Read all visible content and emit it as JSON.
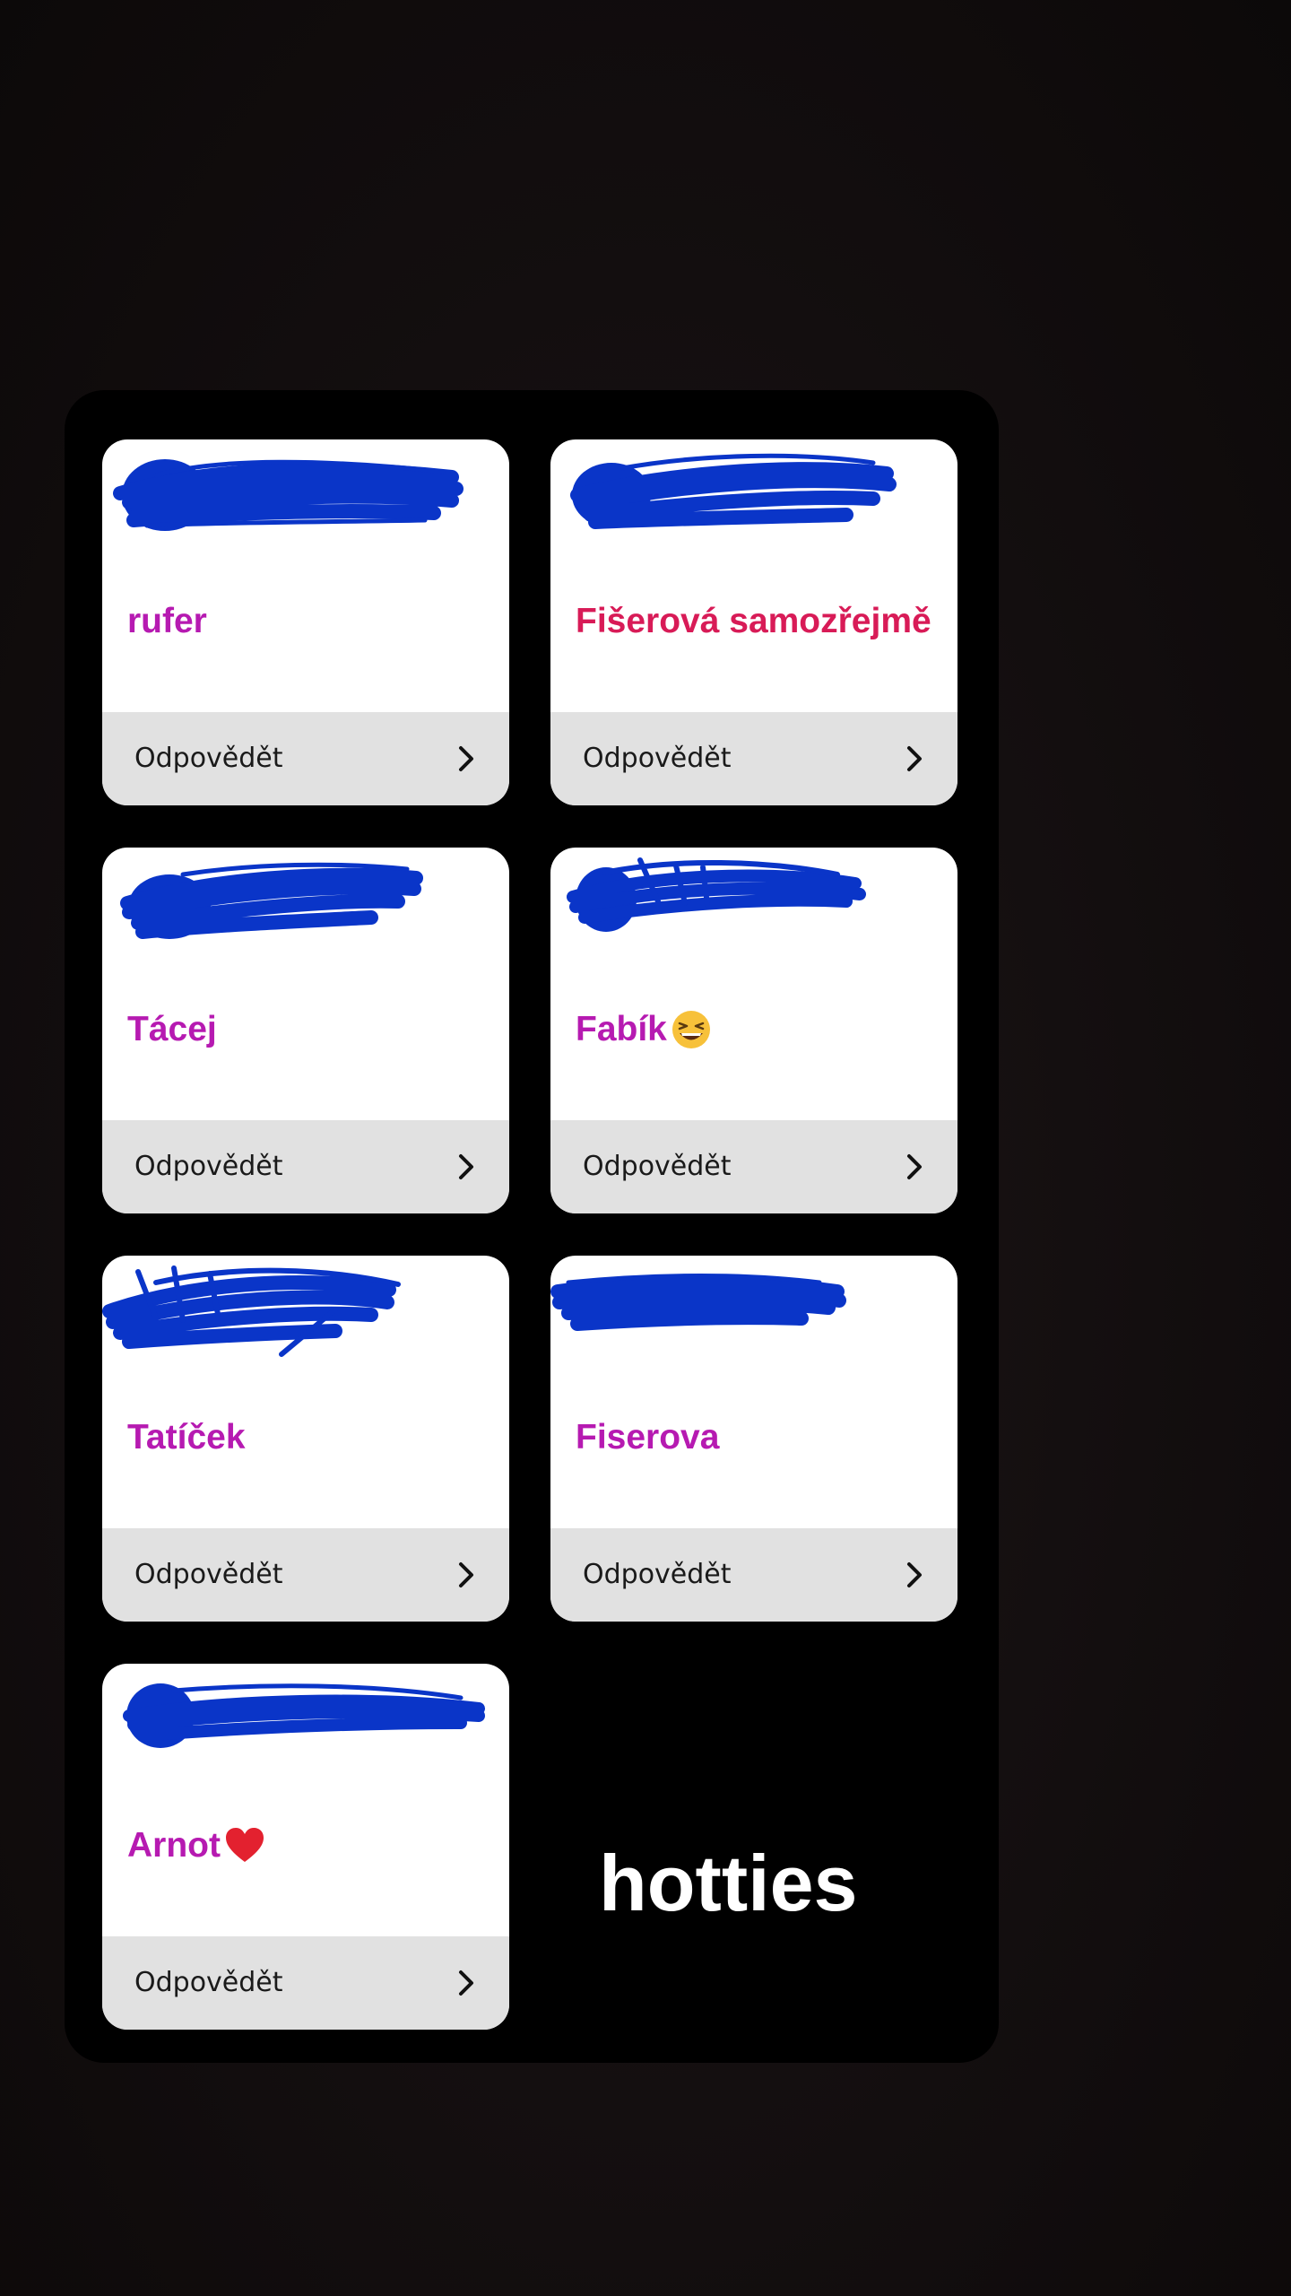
{
  "cards": [
    {
      "name": "rufer",
      "reply_label": "Odpovědět",
      "chevron_icon": "chevron-right"
    },
    {
      "name": "Fišerová samozřejmě",
      "reply_label": "Odpovědět",
      "chevron_icon": "chevron-right"
    },
    {
      "name": "Tácej",
      "reply_label": "Odpovědět",
      "chevron_icon": "chevron-right"
    },
    {
      "name": "Fabík",
      "emoji": "grinning-squinting-face",
      "reply_label": "Odpovědět",
      "chevron_icon": "chevron-right"
    },
    {
      "name": "Tatíček",
      "reply_label": "Odpovědět",
      "chevron_icon": "chevron-right"
    },
    {
      "name": "Fiserova",
      "reply_label": "Odpovědět",
      "chevron_icon": "chevron-right"
    },
    {
      "name": "Arnot",
      "emoji": "red-heart",
      "reply_label": "Odpovědět",
      "chevron_icon": "chevron-right"
    }
  ],
  "caption": "hotties",
  "colors": {
    "name_purple": "#b61ab1",
    "name_red": "#d81b57",
    "scribble_blue": "#0a35c8",
    "reply_bar": "#e1e1e1",
    "panel": "#000000"
  }
}
